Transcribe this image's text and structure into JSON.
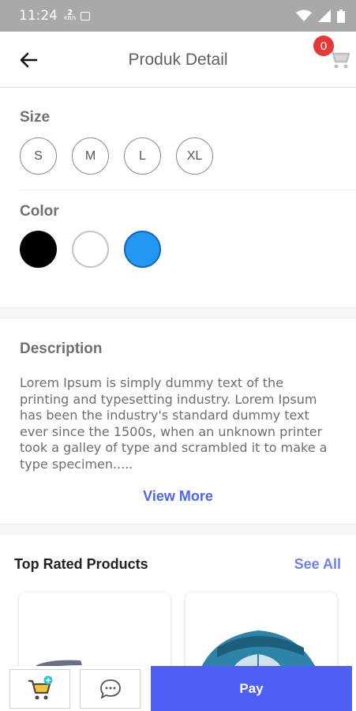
{
  "status_bar": {
    "time": "11:24",
    "net_speed_value": "2",
    "net_speed_unit": "KB/s",
    "icons": [
      "image-icon",
      "wifi-icon",
      "signal-icon",
      "battery-icon"
    ]
  },
  "header": {
    "title": "Produk Detail",
    "cart_count": "0",
    "icons": [
      "back-arrow-icon",
      "cart-icon"
    ]
  },
  "options": {
    "size_label": "Size",
    "sizes": [
      "S",
      "M",
      "L",
      "XL"
    ],
    "color_label": "Color",
    "colors": [
      "#000000",
      "#ffffff",
      "#2196f3"
    ]
  },
  "description": {
    "title": "Description",
    "text": "Lorem Ipsum is simply dummy text of the printing and typesetting industry. Lorem Ipsum has been the industry's standard dummy text ever since the 1500s, when an unknown printer took a galley of type and scrambled it to make a type specimen.....",
    "view_more": "View More"
  },
  "top_rated": {
    "title": "Top Rated Products",
    "see_all": "See All"
  },
  "bottom_bar": {
    "pay_label": "Pay",
    "icons": [
      "add-to-cart-icon",
      "chat-icon"
    ]
  },
  "colors": {
    "accent": "#4e5ff5",
    "link": "#4d64ec",
    "badge": "#e53935"
  }
}
